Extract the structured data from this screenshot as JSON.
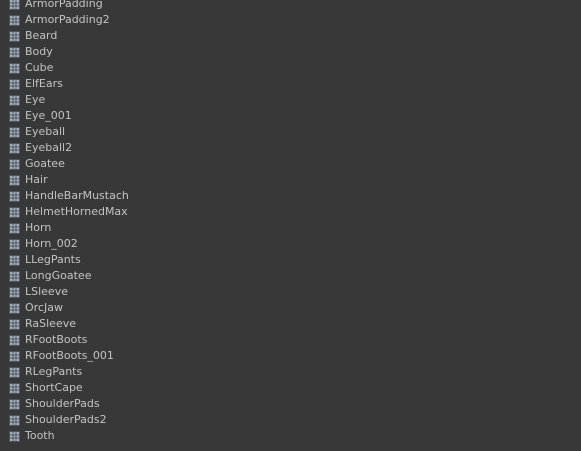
{
  "meshes": {
    "icon": "mesh-grid-icon",
    "items": [
      "ArmorPadding",
      "ArmorPadding2",
      "Beard",
      "Body",
      "Cube",
      "ElfEars",
      "Eye",
      "Eye_001",
      "Eyeball",
      "Eyeball2",
      "Goatee",
      "Hair",
      "HandleBarMustach",
      "HelmetHornedMax",
      "Horn",
      "Horn_002",
      "LLegPants",
      "LongGoatee",
      "LSleeve",
      "OrcJaw",
      "RaSleeve",
      "RFootBoots",
      "RFootBoots_001",
      "RLegPants",
      "ShortCape",
      "ShoulderPads",
      "ShoulderPads2",
      "Tooth"
    ]
  },
  "colors": {
    "background": "#383838",
    "text": "#c4c4c4",
    "icon_fill": "#a8b4bf",
    "icon_grid": "#4a5560"
  }
}
